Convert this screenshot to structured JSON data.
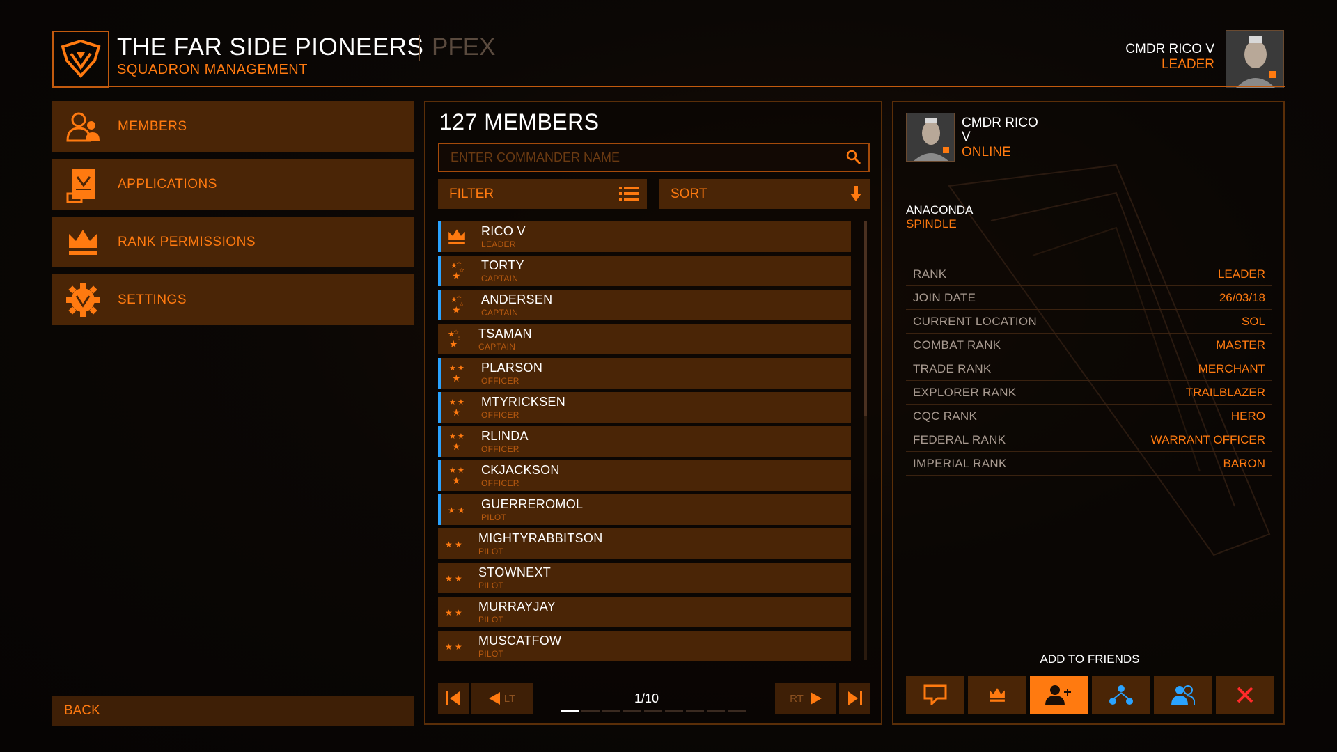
{
  "header": {
    "title": "THE FAR SIDE PIONEERS",
    "tag": "PFEX",
    "subtitle": "SQUADRON MANAGEMENT",
    "cmdr_name": "CMDR RICO V",
    "cmdr_role": "LEADER"
  },
  "nav": {
    "items": [
      {
        "label": "MEMBERS",
        "icon": "members-icon"
      },
      {
        "label": "APPLICATIONS",
        "icon": "applications-icon"
      },
      {
        "label": "RANK PERMISSIONS",
        "icon": "crown-icon"
      },
      {
        "label": "SETTINGS",
        "icon": "gear-icon"
      }
    ],
    "back_label": "BACK"
  },
  "members": {
    "title": "127 MEMBERS",
    "search_placeholder": "ENTER COMMANDER NAME",
    "filter_label": "FILTER",
    "sort_label": "SORT",
    "rows": [
      {
        "name": "RICO V",
        "rank": "LEADER",
        "online": true
      },
      {
        "name": "TORTY",
        "rank": "CAPTAIN",
        "online": true
      },
      {
        "name": "ANDERSEN",
        "rank": "CAPTAIN",
        "online": true
      },
      {
        "name": "TSAMAN",
        "rank": "CAPTAIN",
        "online": false
      },
      {
        "name": "PLARSON",
        "rank": "OFFICER",
        "online": true
      },
      {
        "name": "MTYRICKSEN",
        "rank": "OFFICER",
        "online": true
      },
      {
        "name": "RLINDA",
        "rank": "OFFICER",
        "online": true
      },
      {
        "name": "CKJACKSON",
        "rank": "OFFICER",
        "online": true
      },
      {
        "name": "GUERREROMOL",
        "rank": "PILOT",
        "online": true
      },
      {
        "name": "MIGHTYRABBITSON",
        "rank": "PILOT",
        "online": false
      },
      {
        "name": "STOWNEXT",
        "rank": "PILOT",
        "online": false
      },
      {
        "name": "MURRAYJAY",
        "rank": "PILOT",
        "online": false
      },
      {
        "name": "MUSCATFOW",
        "rank": "PILOT",
        "online": false
      }
    ],
    "pager": {
      "page": "1/10",
      "lt_label": "LT",
      "rt_label": "RT"
    }
  },
  "profile": {
    "cmdr": "CMDR RICO V",
    "status": "ONLINE",
    "ship": "ANACONDA",
    "ship_name": "SPINDLE",
    "stats": [
      {
        "k": "RANK",
        "v": "LEADER"
      },
      {
        "k": "JOIN DATE",
        "v": "26/03/18"
      },
      {
        "k": "CURRENT LOCATION",
        "v": "SOL"
      },
      {
        "k": "COMBAT RANK",
        "v": "MASTER"
      },
      {
        "k": "TRADE RANK",
        "v": "MERCHANT"
      },
      {
        "k": "EXPLORER RANK",
        "v": "TRAILBLAZER"
      },
      {
        "k": "CQC RANK",
        "v": "HERO"
      },
      {
        "k": "FEDERAL RANK",
        "v": "WARRANT OFFICER"
      },
      {
        "k": "IMPERIAL RANK",
        "v": "BARON"
      }
    ],
    "action_hint": "ADD TO FRIENDS"
  },
  "colors": {
    "accent": "#ff7a10",
    "online": "#2aa3ff",
    "danger": "#ff2a2a"
  }
}
